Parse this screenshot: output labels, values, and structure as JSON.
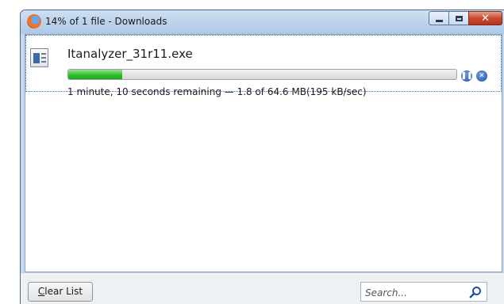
{
  "window": {
    "title": "14% of 1 file - Downloads",
    "app_icon": "firefox-icon",
    "controls": {
      "minimize": "minimize-icon",
      "maximize": "maximize-icon",
      "close": "close-icon"
    }
  },
  "download": {
    "file_name": "Itanalyzer_31r11.exe",
    "file_icon": "executable-file-icon",
    "progress_fraction": 0.14,
    "status": "1 minute, 10 seconds remaining — 1.8 of 64.6 MB(195 kB/sec)",
    "pause_icon": "pause-icon",
    "cancel_icon": "cancel-icon"
  },
  "footer": {
    "clear_button": {
      "accel": "C",
      "rest": "lear List"
    },
    "search": {
      "placeholder": "Search...",
      "value": "",
      "icon": "search-icon"
    }
  },
  "colors": {
    "progress_fill": "#2ebf2e",
    "control_blue": "#1f4fae",
    "close_red": "#c74a2e",
    "frame": "#c6d9ee"
  }
}
